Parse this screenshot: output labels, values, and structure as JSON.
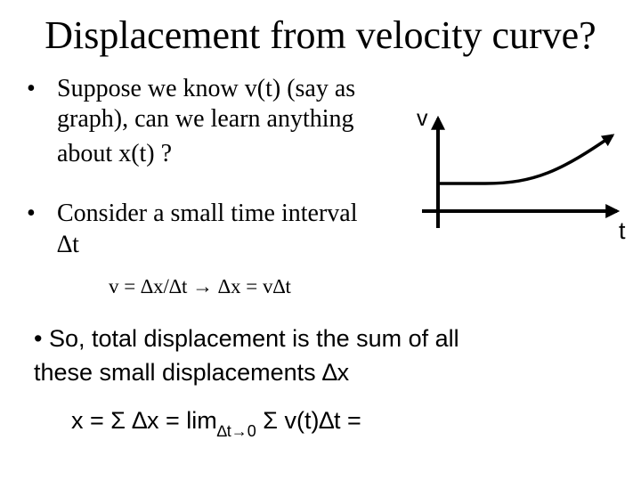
{
  "slide": {
    "title": "Displacement from velocity curve?",
    "bullets": [
      {
        "marker": "•",
        "lines": [
          "Suppose we know v(t) (say as",
          "graph), can we learn anything",
          "about x(t) ?"
        ]
      },
      {
        "marker": "•",
        "lines": [
          "Consider a small time interval",
          "∆t"
        ]
      }
    ],
    "equation_1": "v = ∆x/∆t → ∆x = v∆t",
    "bullet_3": {
      "lines": [
        "• So, total displacement is the sum of all",
        "these small displacements ∆x"
      ]
    },
    "equation_2": {
      "part_a": "x = Σ ∆x = lim",
      "subscript": "∆t→0",
      "part_b": " Σ v(t)∆t ="
    }
  },
  "graph": {
    "y_axis_label": "v",
    "x_axis_label": "t",
    "curve_description": "velocity starts at a positive constant value, stays flat, then increases upward (concave up)",
    "line_color": "#000000"
  }
}
